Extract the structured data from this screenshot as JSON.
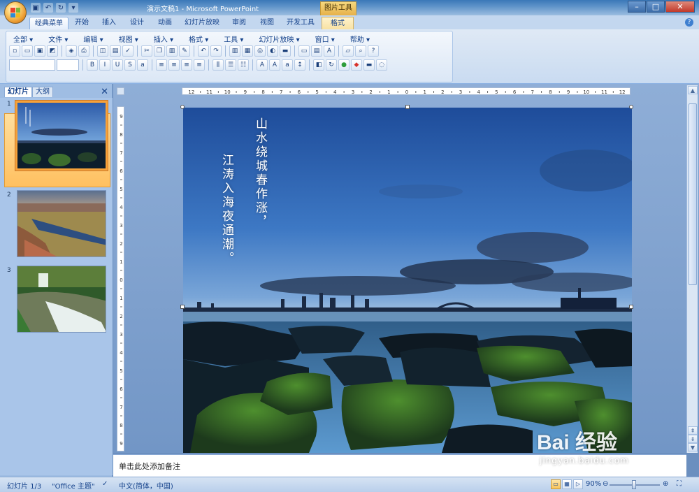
{
  "window": {
    "title": "演示文稿1 - Microsoft PowerPoint",
    "context_tool": "图片工具",
    "controls": [
      "–",
      "□",
      "✕"
    ]
  },
  "tabs": [
    {
      "label": "经典菜单",
      "active": true
    },
    {
      "label": "开始"
    },
    {
      "label": "插入"
    },
    {
      "label": "设计"
    },
    {
      "label": "动画"
    },
    {
      "label": "幻灯片放映"
    },
    {
      "label": "审阅"
    },
    {
      "label": "视图"
    },
    {
      "label": "开发工具"
    },
    {
      "label": "格式",
      "contextual": true
    }
  ],
  "menubar": [
    "全部 ▾",
    "文件 ▾",
    "编辑 ▾",
    "视图 ▾",
    "插入 ▾",
    "格式 ▾",
    "工具 ▾",
    "幻灯片放映 ▾",
    "窗口 ▾",
    "帮助 ▾"
  ],
  "toolbar_icons_row1": [
    "new-icon",
    "open-icon",
    "save-icon",
    "pdf-icon",
    "permission-icon",
    "print-icon",
    "print-preview-icon",
    "research-icon",
    "spelling-icon",
    "cut-icon",
    "copy-icon",
    "paste-icon",
    "format-painter-icon",
    "undo-icon",
    "redo-icon",
    "chart-icon",
    "table-icon",
    "hyperlink-icon",
    "color-icon",
    "shape-icon",
    "new-slide-icon",
    "layout-icon",
    "textbox-icon",
    "folder-icon",
    "zoom-icon",
    "help-icon"
  ],
  "left_pane": {
    "tabs": [
      "幻灯片",
      "大纲"
    ],
    "slides": [
      {
        "number": "1",
        "selected": true
      },
      {
        "number": "2"
      },
      {
        "number": "3"
      }
    ]
  },
  "slide": {
    "poem_line1": "山水绕城春作涨，",
    "poem_line2": "江涛入海夜通潮。"
  },
  "notes": {
    "placeholder": "单击此处添加备注"
  },
  "statusbar": {
    "slide_indicator": "幻灯片 1/3",
    "theme": "\"Office 主题\"",
    "language": "中文(简体，中国)",
    "zoom": "90%"
  },
  "watermark": {
    "brand": "Bai 经验",
    "url": "jingyan.baidu.com"
  },
  "ruler": {
    "h_labels": [
      "12",
      "11",
      "10",
      "9",
      "8",
      "7",
      "6",
      "5",
      "4",
      "3",
      "2",
      "1",
      "0",
      "1",
      "2",
      "3",
      "4",
      "5",
      "6",
      "7",
      "8",
      "9",
      "10",
      "11",
      "12"
    ],
    "v_labels": [
      "9",
      "8",
      "7",
      "6",
      "5",
      "4",
      "3",
      "2",
      "1",
      "0",
      "1",
      "2",
      "3",
      "4",
      "5",
      "6",
      "7",
      "8",
      "9"
    ]
  }
}
